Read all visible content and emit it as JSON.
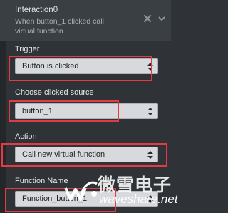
{
  "header": {
    "title": "Interaction0",
    "description": "When button_1 clicked call virtual function"
  },
  "trigger": {
    "label": "Trigger",
    "value": "Button is clicked"
  },
  "source": {
    "label": "Choose clicked source",
    "value": "button_1"
  },
  "action": {
    "label": "Action",
    "value": "Call new virtual function"
  },
  "function": {
    "label": "Function Name",
    "value": "Function_button_1"
  },
  "watermark": {
    "cn": "微雪电子",
    "en": "waveshare.net"
  },
  "colors": {
    "panel": "#2f3337",
    "header": "#3a3f44",
    "field": "#d7d9dc",
    "highlight": "#e53a43"
  }
}
